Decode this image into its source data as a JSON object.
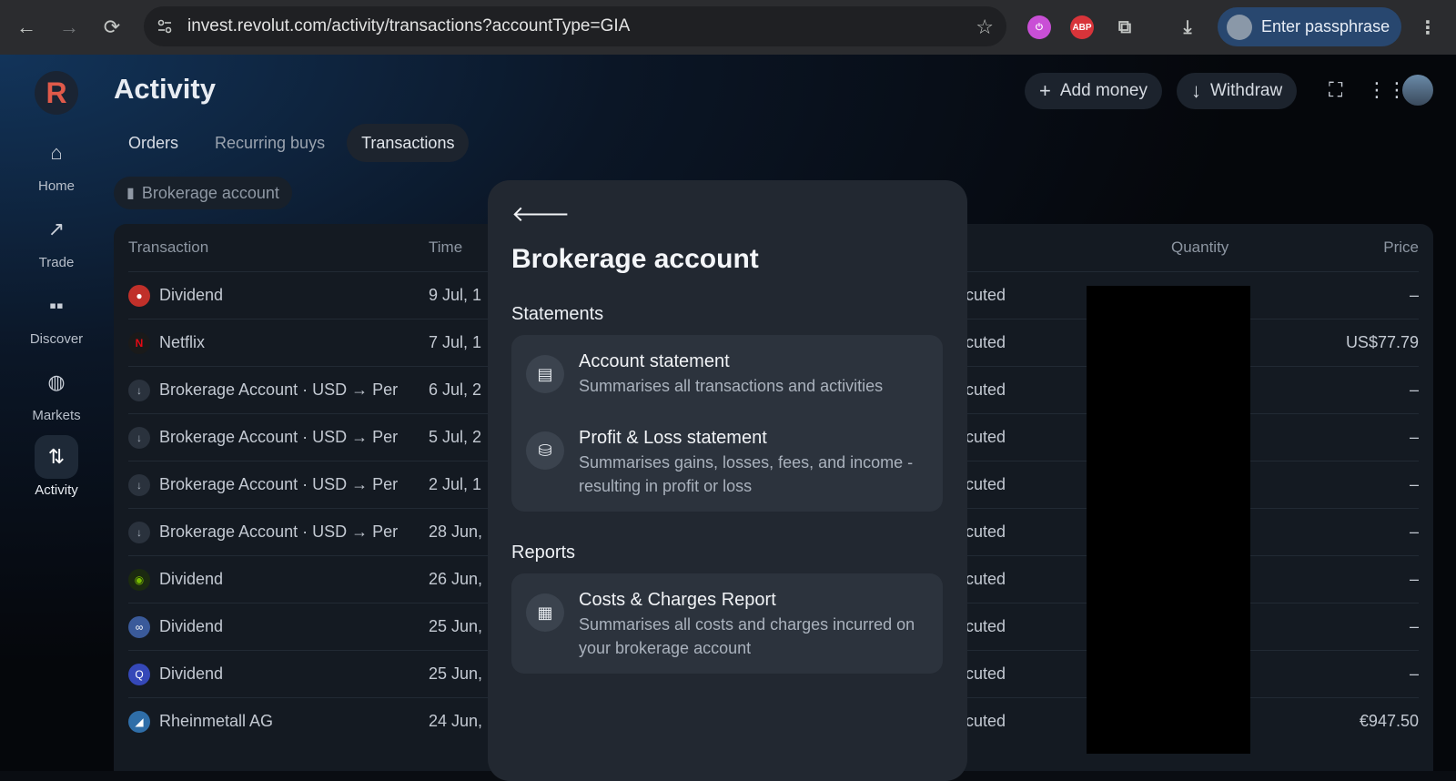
{
  "browser": {
    "url": "invest.revolut.com/activity/transactions?accountType=GIA",
    "passphrase_label": "Enter passphrase",
    "ext_abp": "ABP"
  },
  "sidebar": {
    "logo": "R",
    "items": [
      {
        "label": "Home"
      },
      {
        "label": "Trade"
      },
      {
        "label": "Discover"
      },
      {
        "label": "Markets"
      },
      {
        "label": "Activity"
      }
    ]
  },
  "header": {
    "title": "Activity",
    "add_money": "Add money",
    "withdraw": "Withdraw"
  },
  "tabs": [
    "Orders",
    "Recurring buys",
    "Transactions"
  ],
  "filter_chip": "Brokerage account",
  "table": {
    "headers": {
      "transaction": "Transaction",
      "time": "Time",
      "quantity": "Quantity",
      "price": "Price"
    },
    "rows": [
      {
        "name": "Dividend",
        "time": "9 Jul, 1",
        "status": "cuted",
        "price": "–"
      },
      {
        "name": "Netflix",
        "time": "7 Jul, 1",
        "status": "cuted",
        "price": "US$77.79"
      },
      {
        "name": "Brokerage Account · USD → Per",
        "time": "6 Jul, 2",
        "status": "cuted",
        "price": "–"
      },
      {
        "name": "Brokerage Account · USD → Per",
        "time": "5 Jul, 2",
        "status": "cuted",
        "price": "–"
      },
      {
        "name": "Brokerage Account · USD → Per",
        "time": "2 Jul, 1",
        "status": "cuted",
        "price": "–"
      },
      {
        "name": "Brokerage Account · USD → Per",
        "time": "28 Jun,",
        "status": "cuted",
        "price": "–"
      },
      {
        "name": "Dividend",
        "time": "26 Jun,",
        "status": "cuted",
        "price": "–"
      },
      {
        "name": "Dividend",
        "time": "25 Jun,",
        "status": "cuted",
        "price": "–"
      },
      {
        "name": "Dividend",
        "time": "25 Jun,",
        "status": "cuted",
        "price": "–"
      },
      {
        "name": "Rheinmetall AG",
        "time": "24 Jun,",
        "status": "cuted",
        "price": "€947.50"
      }
    ]
  },
  "modal": {
    "title": "Brokerage account",
    "statements_label": "Statements",
    "reports_label": "Reports",
    "account_statement": {
      "title": "Account statement",
      "desc": "Summarises all transactions and activities"
    },
    "pnl_statement": {
      "title": "Profit & Loss statement",
      "desc": "Summarises gains, losses, fees, and income - resulting in profit or loss"
    },
    "costs_report": {
      "title": "Costs & Charges Report",
      "desc": "Summarises all costs and charges incurred on your brokerage account"
    }
  }
}
